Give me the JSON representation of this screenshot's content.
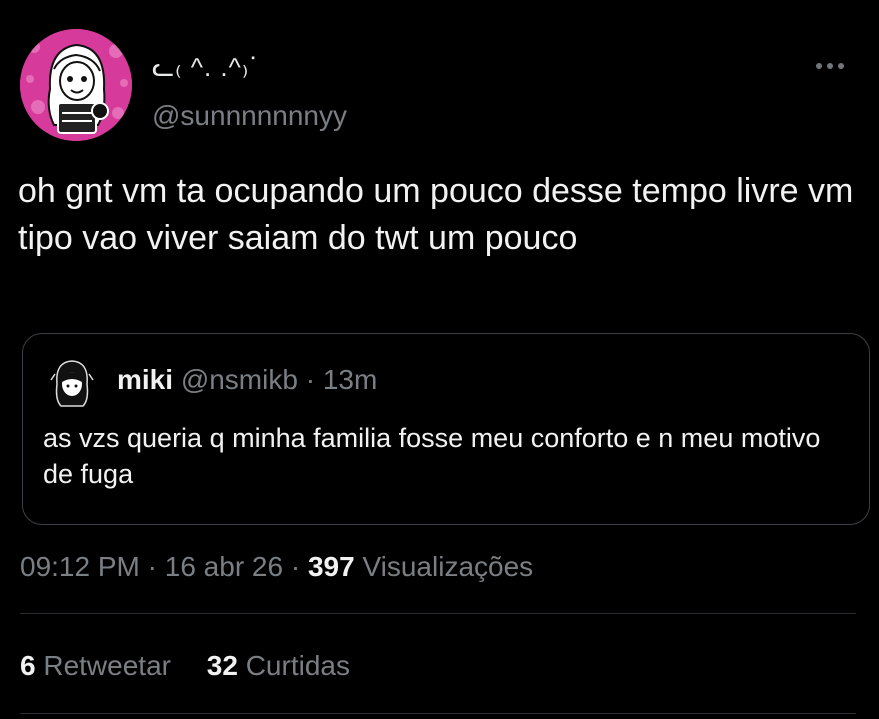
{
  "author": {
    "display_name": "ᓚ₍ ^. .^₎ᐝ",
    "handle": "@sunnnnnnnyy"
  },
  "tweet": {
    "text": "oh gnt vm ta ocupando um pouco desse tempo livre vm tipo vao viver saiam do twt um pouco"
  },
  "quoted_tweet": {
    "name": "miki",
    "handle": "@nsmikb",
    "separator": "·",
    "time": "13m",
    "text": "as vzs queria q minha familia fosse meu conforto e n meu motivo de fuga"
  },
  "meta": {
    "time": "09:12 PM",
    "separator": "·",
    "date": "16 abr 26",
    "views_count": "397",
    "views_label": "Visualizações"
  },
  "stats": {
    "retweets_count": "6",
    "retweets_label": "Retweetar",
    "likes_count": "32",
    "likes_label": "Curtidas"
  },
  "icons": {
    "more": "more-horizontal-icon"
  },
  "colors": {
    "background": "#000000",
    "text": "#e7e9ea",
    "secondary_text": "#7a7f84",
    "border": "#3c3f43",
    "avatar_pink": "#d63a9a"
  }
}
